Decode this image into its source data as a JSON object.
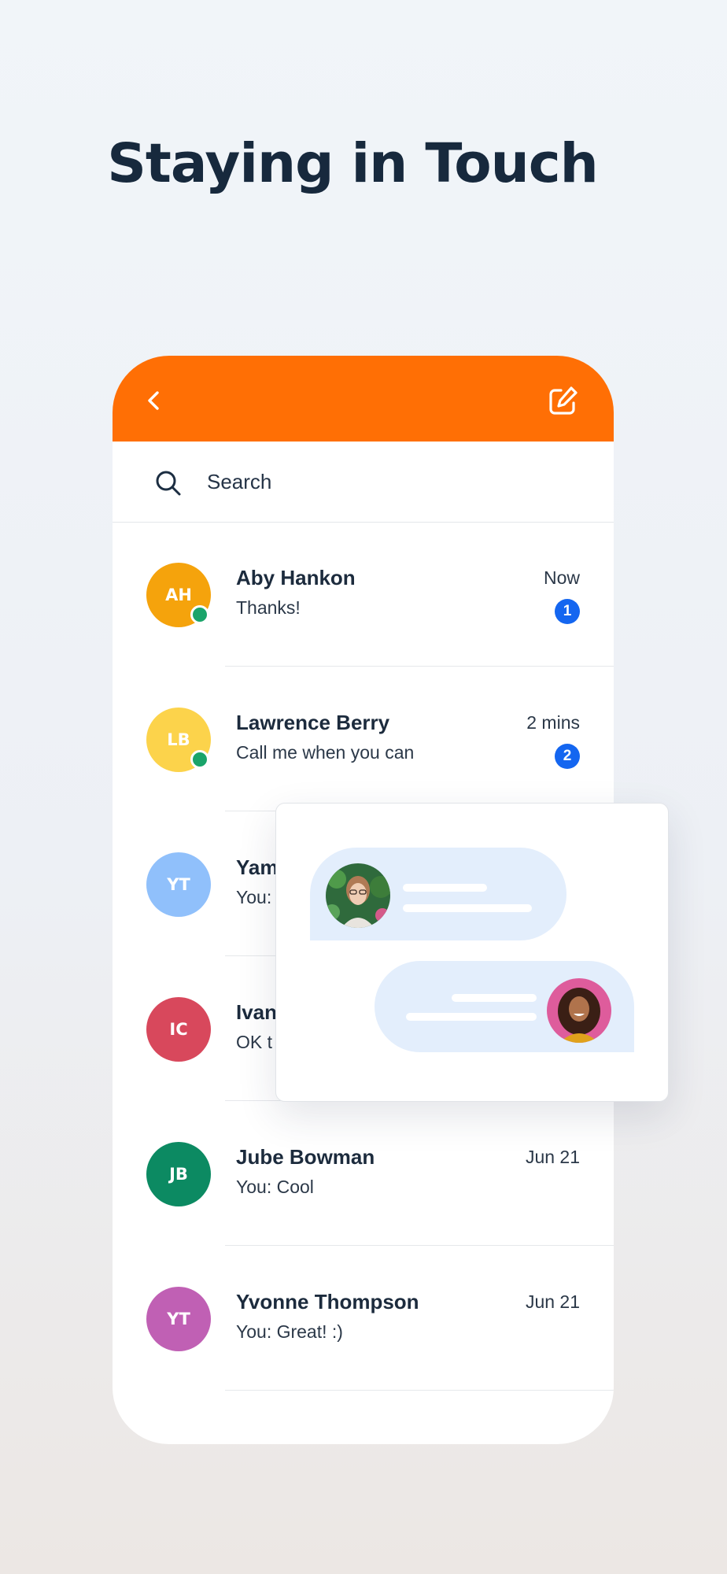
{
  "headline": "Staying in Touch",
  "colors": {
    "accent": "#ff6f05",
    "badge": "#1466f0",
    "online": "#1aa46a",
    "bubble": "#e3eefc"
  },
  "header": {
    "back_icon": "chevron-left-icon",
    "compose_icon": "compose-icon"
  },
  "search": {
    "placeholder": "Search",
    "icon": "search-icon"
  },
  "conversations": [
    {
      "initials": "AH",
      "name": "Aby Hankon",
      "preview": "Thanks!",
      "time": "Now",
      "unread": "1",
      "online": true,
      "color": "#f5a30c"
    },
    {
      "initials": "LB",
      "name": "Lawrence Berry",
      "preview": "Call me when you can",
      "time": "2 mins",
      "unread": "2",
      "online": true,
      "color": "#fcd34b"
    },
    {
      "initials": "YT",
      "name": "Yam",
      "preview": "You:",
      "time": "",
      "unread": "",
      "online": false,
      "color": "#90c0fb"
    },
    {
      "initials": "IC",
      "name": "Ivan",
      "preview": "OK t",
      "time": "",
      "unread": "",
      "online": false,
      "color": "#d8485c"
    },
    {
      "initials": "JB",
      "name": "Jube Bowman",
      "preview": "You: Cool",
      "time": "Jun 21",
      "unread": "",
      "online": false,
      "color": "#0c8a62"
    },
    {
      "initials": "YT",
      "name": "Yvonne Thompson",
      "preview": "You: Great! :)",
      "time": "Jun 21",
      "unread": "",
      "online": false,
      "color": "#c060b4"
    }
  ]
}
